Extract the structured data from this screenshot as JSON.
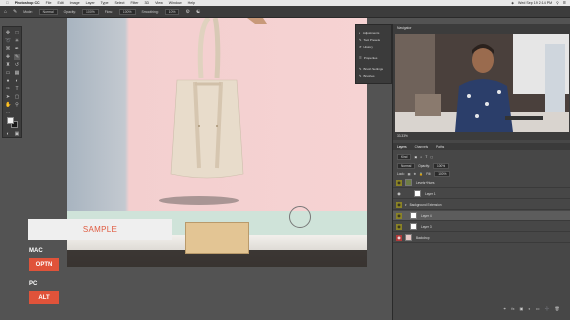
{
  "menubar": {
    "items": [
      "Photoshop CC",
      "File",
      "Edit",
      "Image",
      "Layer",
      "Type",
      "Select",
      "Filter",
      "3D",
      "View",
      "Window",
      "Help"
    ],
    "clock": "Wed Sep 19 2:14 PM"
  },
  "options": {
    "mode_label": "Mode:",
    "mode_value": "Normal",
    "opacity_label": "Opacity:",
    "opacity_value": "100%",
    "flow_label": "Flow:",
    "flow_value": "100%",
    "smoothing_label": "Smoothing:",
    "smoothing_value": "10%"
  },
  "panel_menu": {
    "items": [
      "Adjustments",
      "Tool Presets",
      "History",
      "Properties",
      "Brush Settings",
      "Brushes"
    ]
  },
  "navigator": {
    "tab": "Navigator",
    "zoom": "33.33%"
  },
  "layers_panel": {
    "tabs": [
      "Layers",
      "Channels",
      "Paths"
    ],
    "blend_mode": "Normal",
    "opacity_label": "Opacity:",
    "opacity_value": "100%",
    "fill_label": "Fill:",
    "fill_value": "100%",
    "kind_filter": "Kind",
    "lock_label": "Lock:",
    "layers": [
      {
        "name": "Levels+Hues",
        "visible": true
      },
      {
        "name": "Layer 1",
        "visible": true
      },
      {
        "name": "Background Extension",
        "visible": true
      },
      {
        "name": "Layer 4",
        "visible": true
      },
      {
        "name": "Layer 3",
        "visible": true
      },
      {
        "name": "Backdrop",
        "visible": true
      }
    ]
  },
  "overlay": {
    "sample_label": "SAMPLE",
    "mac_label": "MAC",
    "mac_key": "OPTN",
    "pc_label": "PC",
    "pc_key": "ALT"
  },
  "colors": {
    "accent": "#e0533a",
    "canvas_bg": "#535353",
    "panel_bg": "#3c3c3c"
  }
}
